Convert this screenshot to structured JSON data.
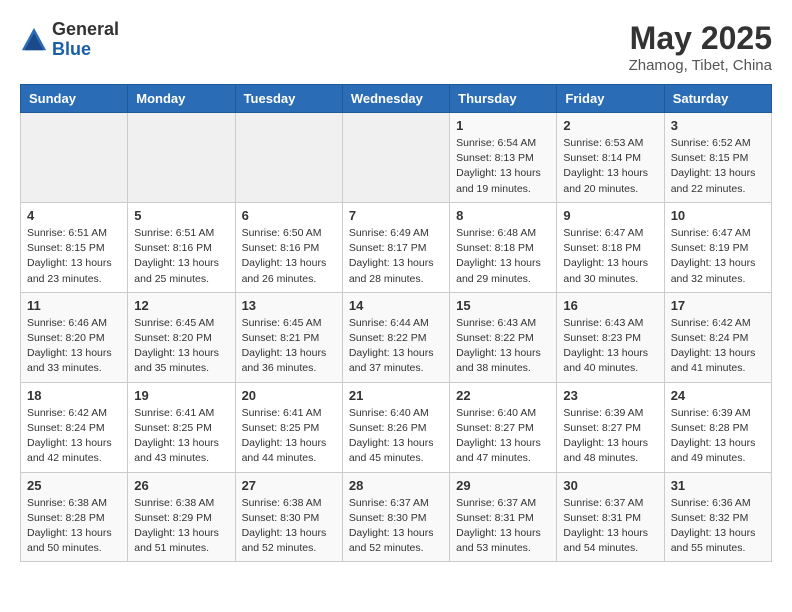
{
  "header": {
    "logo_general": "General",
    "logo_blue": "Blue",
    "month_year": "May 2025",
    "location": "Zhamog, Tibet, China"
  },
  "days_of_week": [
    "Sunday",
    "Monday",
    "Tuesday",
    "Wednesday",
    "Thursday",
    "Friday",
    "Saturday"
  ],
  "weeks": [
    [
      {
        "day": "",
        "info": ""
      },
      {
        "day": "",
        "info": ""
      },
      {
        "day": "",
        "info": ""
      },
      {
        "day": "",
        "info": ""
      },
      {
        "day": "1",
        "info": "Sunrise: 6:54 AM\nSunset: 8:13 PM\nDaylight: 13 hours\nand 19 minutes."
      },
      {
        "day": "2",
        "info": "Sunrise: 6:53 AM\nSunset: 8:14 PM\nDaylight: 13 hours\nand 20 minutes."
      },
      {
        "day": "3",
        "info": "Sunrise: 6:52 AM\nSunset: 8:15 PM\nDaylight: 13 hours\nand 22 minutes."
      }
    ],
    [
      {
        "day": "4",
        "info": "Sunrise: 6:51 AM\nSunset: 8:15 PM\nDaylight: 13 hours\nand 23 minutes."
      },
      {
        "day": "5",
        "info": "Sunrise: 6:51 AM\nSunset: 8:16 PM\nDaylight: 13 hours\nand 25 minutes."
      },
      {
        "day": "6",
        "info": "Sunrise: 6:50 AM\nSunset: 8:16 PM\nDaylight: 13 hours\nand 26 minutes."
      },
      {
        "day": "7",
        "info": "Sunrise: 6:49 AM\nSunset: 8:17 PM\nDaylight: 13 hours\nand 28 minutes."
      },
      {
        "day": "8",
        "info": "Sunrise: 6:48 AM\nSunset: 8:18 PM\nDaylight: 13 hours\nand 29 minutes."
      },
      {
        "day": "9",
        "info": "Sunrise: 6:47 AM\nSunset: 8:18 PM\nDaylight: 13 hours\nand 30 minutes."
      },
      {
        "day": "10",
        "info": "Sunrise: 6:47 AM\nSunset: 8:19 PM\nDaylight: 13 hours\nand 32 minutes."
      }
    ],
    [
      {
        "day": "11",
        "info": "Sunrise: 6:46 AM\nSunset: 8:20 PM\nDaylight: 13 hours\nand 33 minutes."
      },
      {
        "day": "12",
        "info": "Sunrise: 6:45 AM\nSunset: 8:20 PM\nDaylight: 13 hours\nand 35 minutes."
      },
      {
        "day": "13",
        "info": "Sunrise: 6:45 AM\nSunset: 8:21 PM\nDaylight: 13 hours\nand 36 minutes."
      },
      {
        "day": "14",
        "info": "Sunrise: 6:44 AM\nSunset: 8:22 PM\nDaylight: 13 hours\nand 37 minutes."
      },
      {
        "day": "15",
        "info": "Sunrise: 6:43 AM\nSunset: 8:22 PM\nDaylight: 13 hours\nand 38 minutes."
      },
      {
        "day": "16",
        "info": "Sunrise: 6:43 AM\nSunset: 8:23 PM\nDaylight: 13 hours\nand 40 minutes."
      },
      {
        "day": "17",
        "info": "Sunrise: 6:42 AM\nSunset: 8:24 PM\nDaylight: 13 hours\nand 41 minutes."
      }
    ],
    [
      {
        "day": "18",
        "info": "Sunrise: 6:42 AM\nSunset: 8:24 PM\nDaylight: 13 hours\nand 42 minutes."
      },
      {
        "day": "19",
        "info": "Sunrise: 6:41 AM\nSunset: 8:25 PM\nDaylight: 13 hours\nand 43 minutes."
      },
      {
        "day": "20",
        "info": "Sunrise: 6:41 AM\nSunset: 8:25 PM\nDaylight: 13 hours\nand 44 minutes."
      },
      {
        "day": "21",
        "info": "Sunrise: 6:40 AM\nSunset: 8:26 PM\nDaylight: 13 hours\nand 45 minutes."
      },
      {
        "day": "22",
        "info": "Sunrise: 6:40 AM\nSunset: 8:27 PM\nDaylight: 13 hours\nand 47 minutes."
      },
      {
        "day": "23",
        "info": "Sunrise: 6:39 AM\nSunset: 8:27 PM\nDaylight: 13 hours\nand 48 minutes."
      },
      {
        "day": "24",
        "info": "Sunrise: 6:39 AM\nSunset: 8:28 PM\nDaylight: 13 hours\nand 49 minutes."
      }
    ],
    [
      {
        "day": "25",
        "info": "Sunrise: 6:38 AM\nSunset: 8:28 PM\nDaylight: 13 hours\nand 50 minutes."
      },
      {
        "day": "26",
        "info": "Sunrise: 6:38 AM\nSunset: 8:29 PM\nDaylight: 13 hours\nand 51 minutes."
      },
      {
        "day": "27",
        "info": "Sunrise: 6:38 AM\nSunset: 8:30 PM\nDaylight: 13 hours\nand 52 minutes."
      },
      {
        "day": "28",
        "info": "Sunrise: 6:37 AM\nSunset: 8:30 PM\nDaylight: 13 hours\nand 52 minutes."
      },
      {
        "day": "29",
        "info": "Sunrise: 6:37 AM\nSunset: 8:31 PM\nDaylight: 13 hours\nand 53 minutes."
      },
      {
        "day": "30",
        "info": "Sunrise: 6:37 AM\nSunset: 8:31 PM\nDaylight: 13 hours\nand 54 minutes."
      },
      {
        "day": "31",
        "info": "Sunrise: 6:36 AM\nSunset: 8:32 PM\nDaylight: 13 hours\nand 55 minutes."
      }
    ]
  ]
}
